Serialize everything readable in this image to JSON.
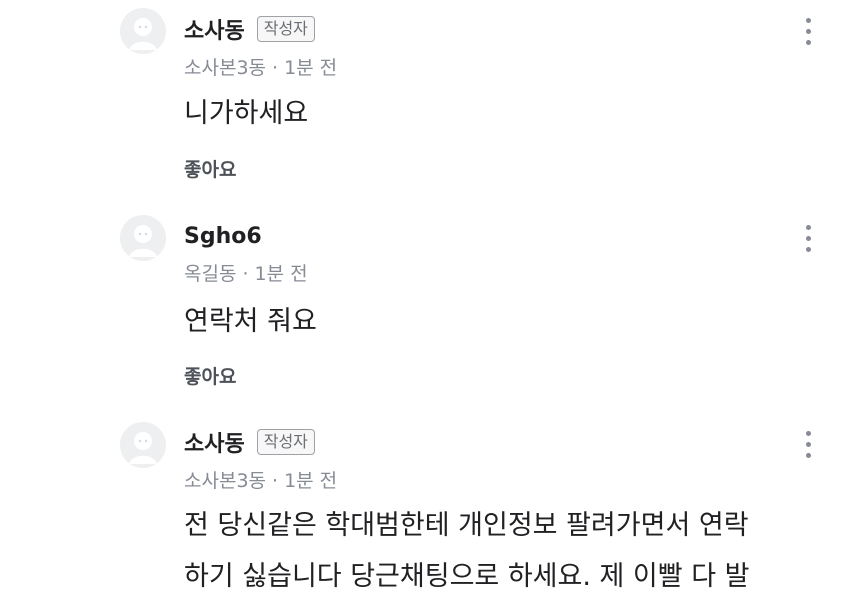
{
  "comments": [
    {
      "author": "소사동",
      "badge": "작성자",
      "location": "소사본3동",
      "separator": "·",
      "time": "1분 전",
      "body_lines": [
        "니가하세요"
      ],
      "like_label": "좋아요"
    },
    {
      "author": "Sgho6",
      "badge": "",
      "location": "옥길동",
      "separator": "·",
      "time": "1분 전",
      "body_lines": [
        "연락처 줘요"
      ],
      "like_label": "좋아요"
    },
    {
      "author": "소사동",
      "badge": "작성자",
      "location": "소사본3동",
      "separator": "·",
      "time": "1분 전",
      "body_lines": [
        "전 당신같은 학대범한테 개인정보 팔려가면서 연락",
        "하기 싫습니다 당근채팅으로 하세요. 제 이빨 다 발"
      ],
      "like_label": ""
    }
  ],
  "icons": {
    "avatar": "default-profile-icon",
    "more": "more-vertical-icon"
  },
  "colors": {
    "text_primary": "#212124",
    "text_secondary": "#868b94",
    "avatar_bg": "#eeeff1",
    "badge_border": "#9ea1a6"
  }
}
